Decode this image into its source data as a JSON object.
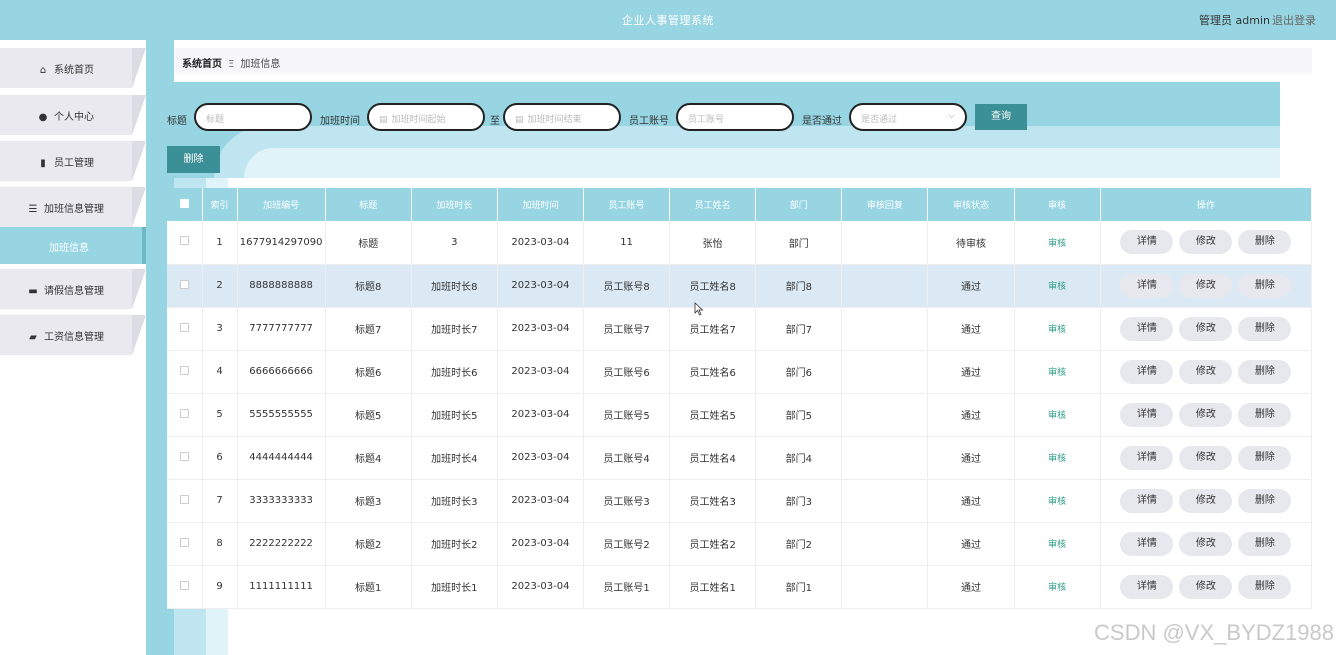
{
  "header": {
    "title": "企业人事管理系统",
    "user": "管理员 admin",
    "logout": "退出登录"
  },
  "sidebar": {
    "items": [
      {
        "label": "系统首页",
        "icon": "home-icon"
      },
      {
        "label": "个人中心",
        "icon": "user-icon"
      },
      {
        "label": "员工管理",
        "icon": "book-icon"
      },
      {
        "label": "加班信息管理",
        "icon": "list-icon"
      },
      {
        "label": "请假信息管理",
        "icon": "laptop-icon"
      },
      {
        "label": "工资信息管理",
        "icon": "briefcase-icon"
      }
    ],
    "active_sub": "加班信息"
  },
  "breadcrumb": {
    "home": "系统首页",
    "sep": "Ξ",
    "current": "加班信息"
  },
  "search": {
    "title_label": "标题",
    "title_placeholder": "标题",
    "time_label": "加班时间",
    "start_placeholder": "加班时间起始",
    "to": "至",
    "end_placeholder": "加班时间结束",
    "account_label": "员工账号",
    "account_placeholder": "员工账号",
    "pass_label": "是否通过",
    "pass_placeholder": "是否通过",
    "query": "查询"
  },
  "actions": {
    "delete": "删除"
  },
  "table": {
    "headers": [
      "索引",
      "加班编号",
      "标题",
      "加班时长",
      "加班时间",
      "员工账号",
      "员工姓名",
      "部门",
      "审核回复",
      "审核状态",
      "审核",
      "操作"
    ],
    "op_labels": {
      "detail": "详情",
      "edit": "修改",
      "delete": "删除"
    },
    "rows": [
      {
        "index": "1",
        "no": "1677914297090",
        "title": "标题",
        "duration": "3",
        "time": "2023-03-04",
        "account": "11",
        "name": "张怡",
        "dept": "部门",
        "reply": "",
        "status": "待审核",
        "audit": "审核"
      },
      {
        "index": "2",
        "no": "8888888888",
        "title": "标题8",
        "duration": "加班时长8",
        "time": "2023-03-04",
        "account": "员工账号8",
        "name": "员工姓名8",
        "dept": "部门8",
        "reply": "",
        "status": "通过",
        "audit": "审核"
      },
      {
        "index": "3",
        "no": "7777777777",
        "title": "标题7",
        "duration": "加班时长7",
        "time": "2023-03-04",
        "account": "员工账号7",
        "name": "员工姓名7",
        "dept": "部门7",
        "reply": "",
        "status": "通过",
        "audit": "审核"
      },
      {
        "index": "4",
        "no": "6666666666",
        "title": "标题6",
        "duration": "加班时长6",
        "time": "2023-03-04",
        "account": "员工账号6",
        "name": "员工姓名6",
        "dept": "部门6",
        "reply": "",
        "status": "通过",
        "audit": "审核"
      },
      {
        "index": "5",
        "no": "5555555555",
        "title": "标题5",
        "duration": "加班时长5",
        "time": "2023-03-04",
        "account": "员工账号5",
        "name": "员工姓名5",
        "dept": "部门5",
        "reply": "",
        "status": "通过",
        "audit": "审核"
      },
      {
        "index": "6",
        "no": "4444444444",
        "title": "标题4",
        "duration": "加班时长4",
        "time": "2023-03-04",
        "account": "员工账号4",
        "name": "员工姓名4",
        "dept": "部门4",
        "reply": "",
        "status": "通过",
        "audit": "审核"
      },
      {
        "index": "7",
        "no": "3333333333",
        "title": "标题3",
        "duration": "加班时长3",
        "time": "2023-03-04",
        "account": "员工账号3",
        "name": "员工姓名3",
        "dept": "部门3",
        "reply": "",
        "status": "通过",
        "audit": "审核"
      },
      {
        "index": "8",
        "no": "2222222222",
        "title": "标题2",
        "duration": "加班时长2",
        "time": "2023-03-04",
        "account": "员工账号2",
        "name": "员工姓名2",
        "dept": "部门2",
        "reply": "",
        "status": "通过",
        "audit": "审核"
      },
      {
        "index": "9",
        "no": "1111111111",
        "title": "标题1",
        "duration": "加班时长1",
        "time": "2023-03-04",
        "account": "员工账号1",
        "name": "员工姓名1",
        "dept": "部门1",
        "reply": "",
        "status": "通过",
        "audit": "审核"
      }
    ]
  },
  "watermark": "CSDN @VX_BYDZ1988",
  "colors": {
    "primary": "#97d5e3",
    "button": "#3b8f96",
    "audit_link": "#2f9e8a",
    "row_highlight": "#dbe9f4"
  }
}
